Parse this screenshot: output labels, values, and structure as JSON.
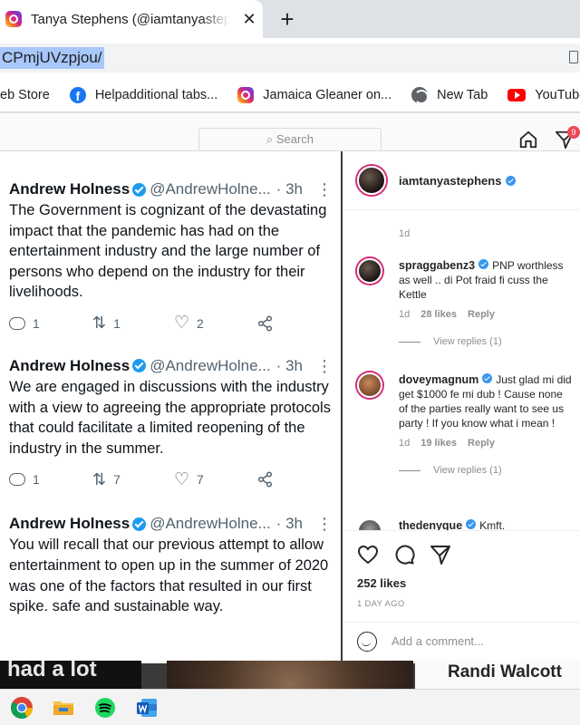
{
  "browser": {
    "tab_title": "Tanya Stephens (@iamtanyasteph",
    "tab_close": "✕",
    "new_tab": "+",
    "url": "CPmjUVzpjou/",
    "bookmarks": [
      {
        "label": "eb Store",
        "icon": "none"
      },
      {
        "label": "Helpadditional tabs...",
        "icon": "facebook-icon"
      },
      {
        "label": "Jamaica Gleaner on...",
        "icon": "instagram-icon"
      },
      {
        "label": "New Tab",
        "icon": "globe-icon"
      },
      {
        "label": "YouTube",
        "icon": "youtube-icon"
      }
    ]
  },
  "instagram": {
    "search_placeholder": "Search",
    "notification_count": "9",
    "post": {
      "owner": "iamtanyastephens",
      "time": "1d",
      "comments": [
        {
          "user": "spraggabenz3",
          "text": "PNP worthless as well .. di Pot fraid fi cuss the Kettle",
          "time": "1d",
          "likes": "28 likes",
          "reply": "Reply",
          "view_replies": "View replies (1)"
        },
        {
          "user": "doveymagnum",
          "text": "Just glad mi did get $1000 fe mi dub ! Cause none of the parties really want to see us party ! If you know what i mean !",
          "time": "1d",
          "likes": "19 likes",
          "reply": "Reply",
          "view_replies": "View replies (1)"
        },
        {
          "user": "thedenyque",
          "text": "Kmft."
        }
      ],
      "likes": "252 likes",
      "posted_ago": "1 DAY AGO",
      "add_comment_placeholder": "Add a comment..."
    }
  },
  "tweets": [
    {
      "name": "Andrew Holness",
      "handle": "@AndrewHolne...",
      "time": "· 3h",
      "text": "The Government is cognizant of the devastating impact that the pandemic has had on the entertainment industry and the large number of persons who depend on the industry for their livelihoods.",
      "replies": "1",
      "retweets": "1",
      "likes": "2"
    },
    {
      "name": "Andrew Holness",
      "handle": "@AndrewHolne...",
      "time": "· 3h",
      "text": "We are engaged in discussions with the industry with a view to agreeing the appropriate protocols that could facilitate a limited reopening of the industry in the summer.",
      "replies": "1",
      "retweets": "7",
      "likes": "7"
    },
    {
      "name": "Andrew Holness",
      "handle": "@AndrewHolne...",
      "time": "· 3h",
      "text": "You will recall that our previous attempt to allow entertainment to open up in the summer of 2020 was one of the factors that resulted in our first spike. safe and sustainable way."
    }
  ],
  "feed": {
    "left_caption": "had a lot",
    "right_caption": "Randi Walcott"
  },
  "colors": {
    "twitter_blue": "#1d9bf0",
    "instagram_blue": "#3897f0",
    "notification_red": "#ed4956"
  },
  "taskbar": [
    "chrome-icon",
    "file-explorer-icon",
    "spotify-icon",
    "word-icon"
  ]
}
